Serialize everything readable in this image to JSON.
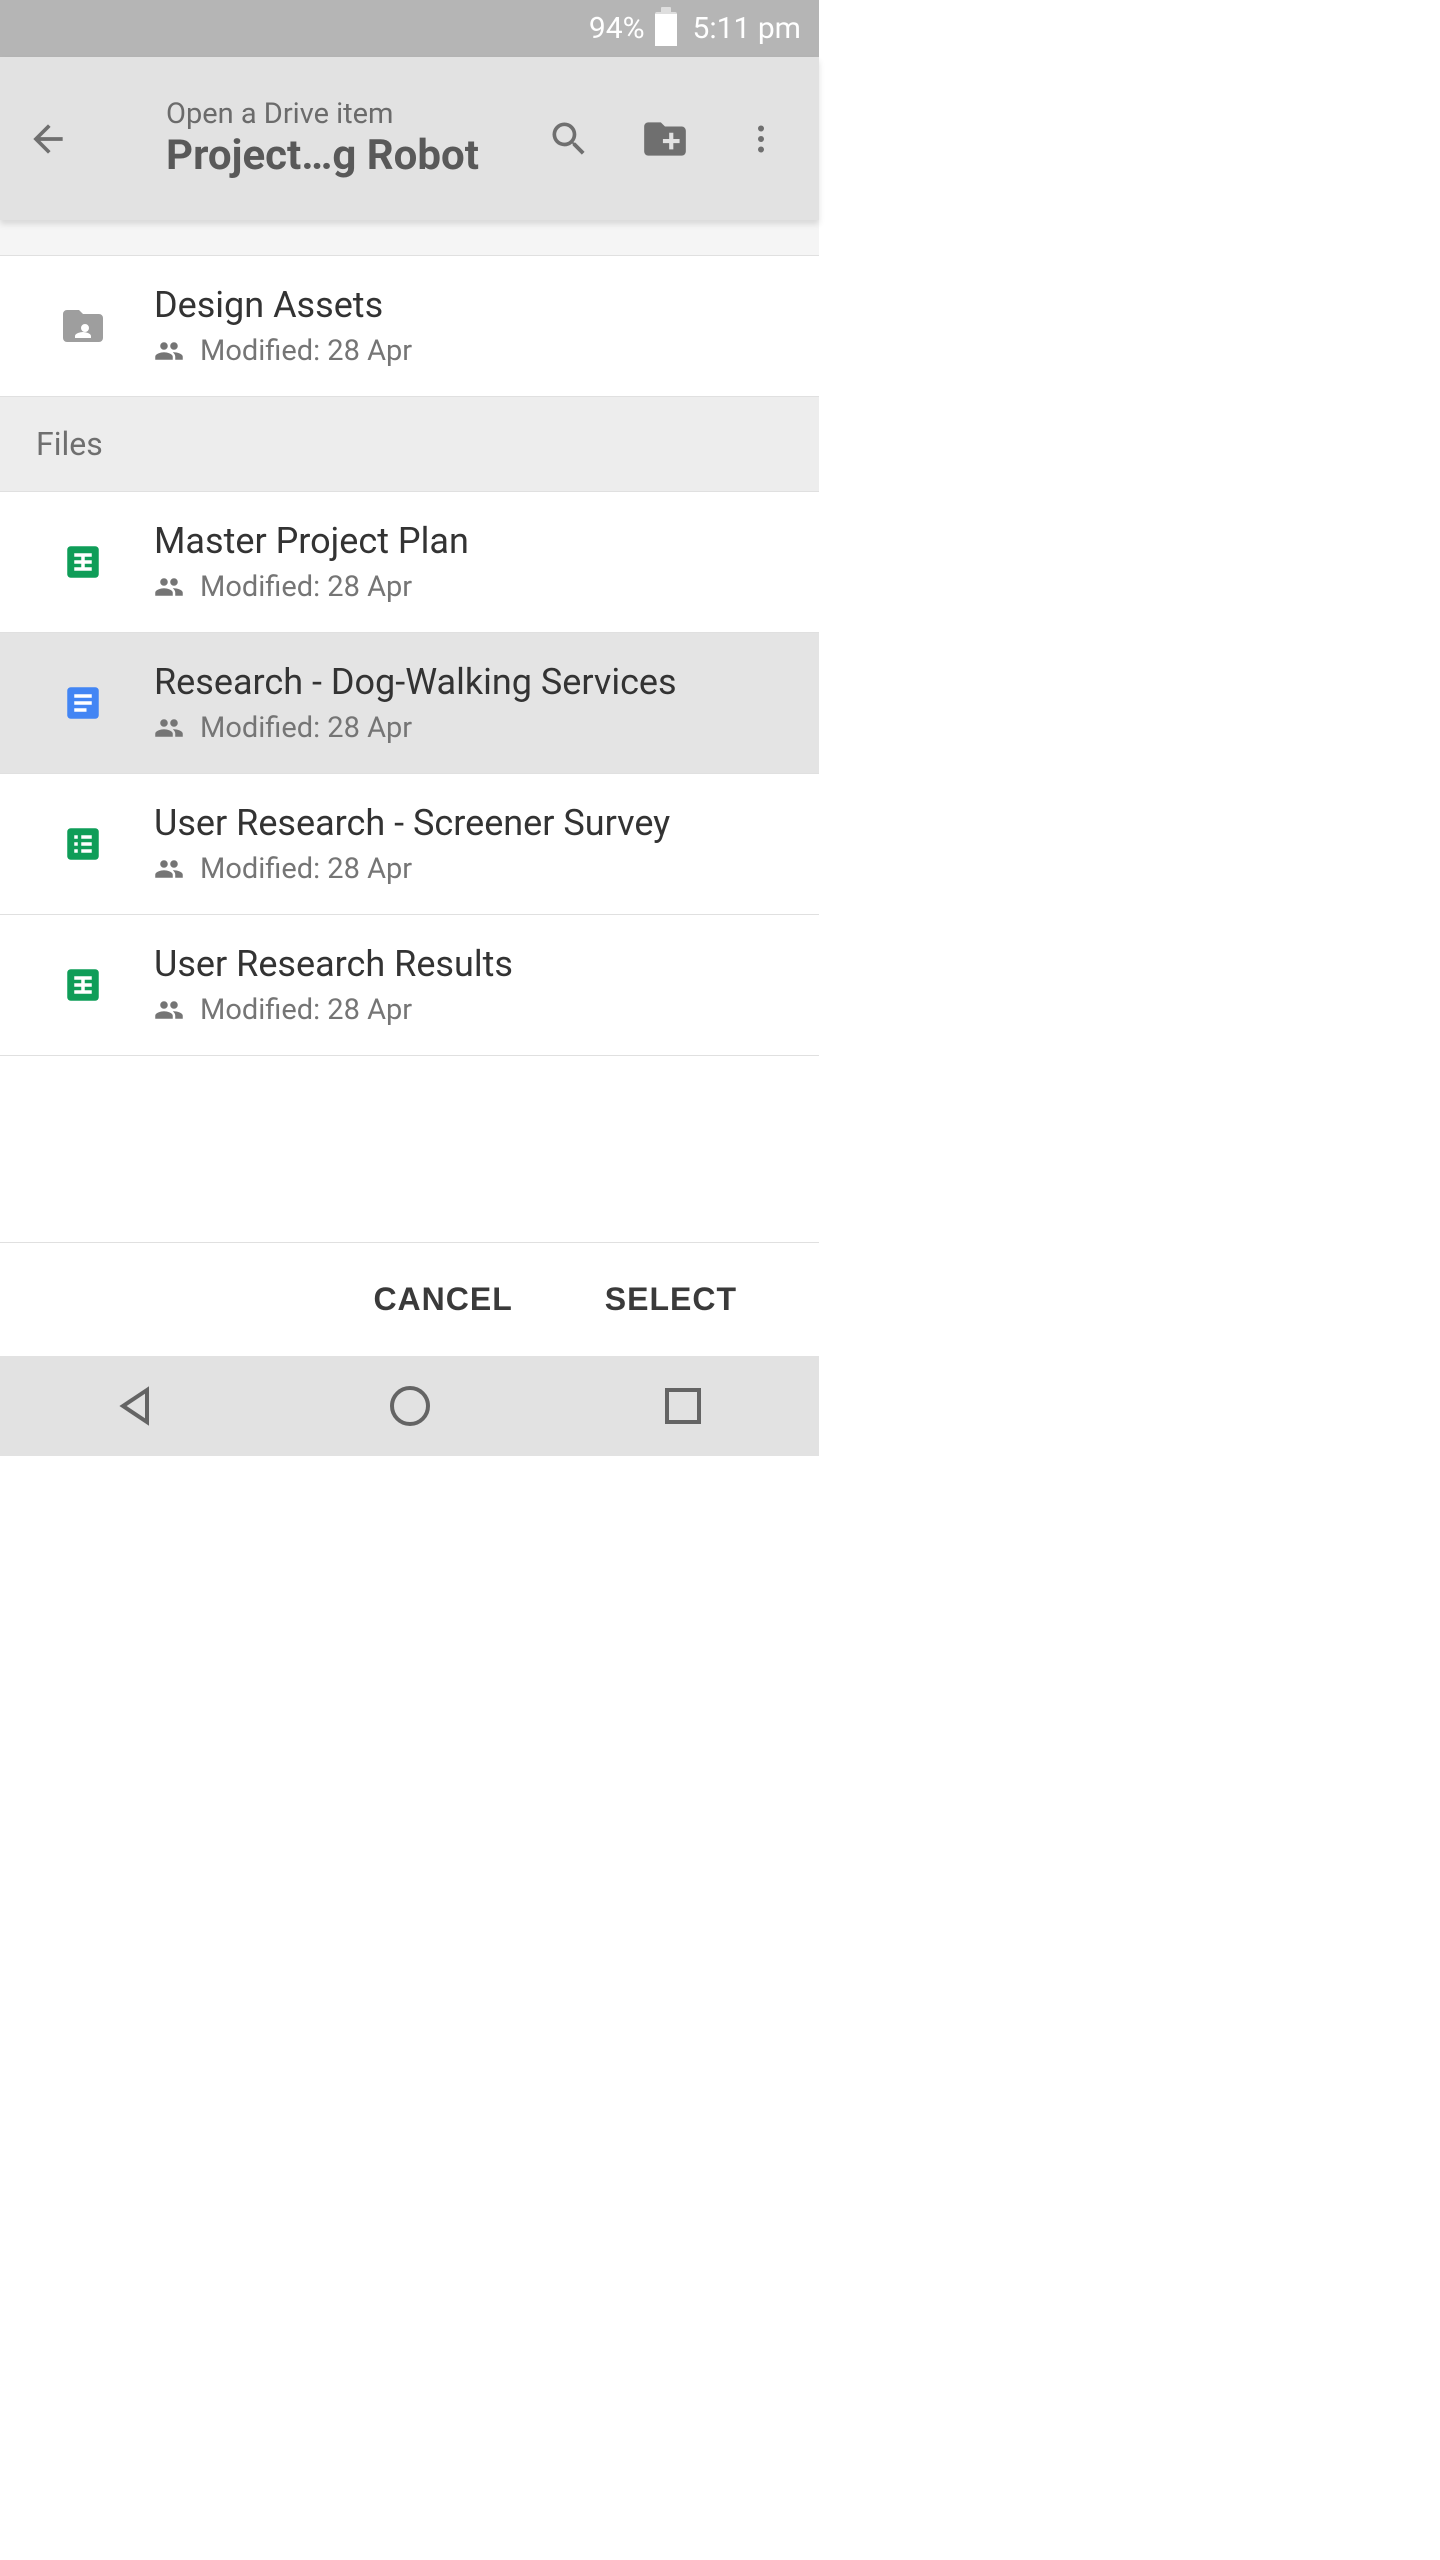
{
  "status": {
    "battery_pct": "94%",
    "clock": "5:11 pm",
    "battery_level_pct": 94
  },
  "appbar": {
    "subtitle": "Open a Drive item",
    "title": "Project…g Robot"
  },
  "folders": [
    {
      "name": "Design Assets",
      "modified": "Modified: 28 Apr",
      "icon": "shared-folder"
    }
  ],
  "section_files_label": "Files",
  "files": [
    {
      "name": "Master Project Plan",
      "modified": "Modified: 28 Apr",
      "icon": "sheets",
      "selected": false
    },
    {
      "name": "Research - Dog-Walking Services",
      "modified": "Modified: 28 Apr",
      "icon": "docs",
      "selected": true
    },
    {
      "name": "User Research - Screener Survey",
      "modified": "Modified: 28 Apr",
      "icon": "forms",
      "selected": false
    },
    {
      "name": "User Research Results",
      "modified": "Modified: 28 Apr",
      "icon": "sheets",
      "selected": false
    }
  ],
  "actions": {
    "cancel": "CANCEL",
    "select": "SELECT"
  },
  "icons": {
    "sheets": "sheets-icon",
    "docs": "docs-icon",
    "forms": "forms-icon",
    "shared-folder": "shared-folder-icon"
  }
}
